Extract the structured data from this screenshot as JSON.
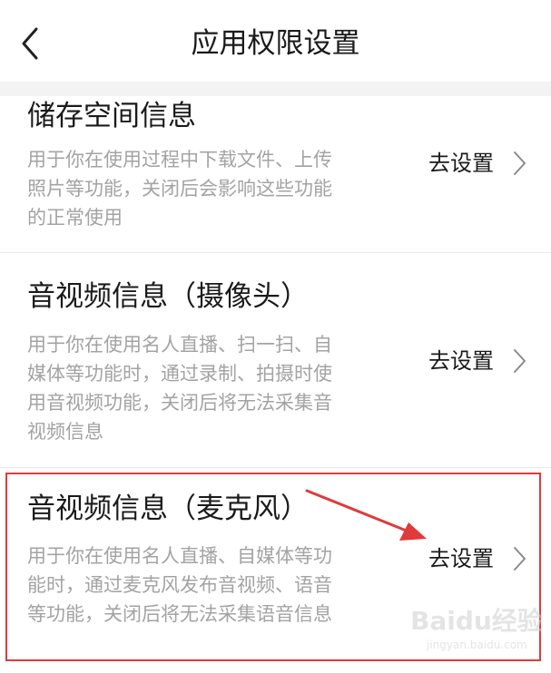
{
  "header": {
    "title": "应用权限设置",
    "back_icon": "chevron-left-icon"
  },
  "items": [
    {
      "title": "储存空间信息",
      "desc_lines": [
        "用于你在使用过程中下载文件、上传",
        "照片等功能，关闭后会影响这些功能",
        "的正常使用"
      ],
      "action": "去设置"
    },
    {
      "title": "音视频信息（摄像头）",
      "desc_lines": [
        "用于你在使用名人直播、扫一扫、自",
        "媒体等功能时，通过录制、拍摄时使",
        "用音视频功能，关闭后将无法采集音",
        "视频信息"
      ],
      "action": "去设置"
    },
    {
      "title": "音视频信息（麦克风）",
      "desc_lines": [
        "用于你在使用名人直播、自媒体等功",
        "能时，通过麦克风发布音视频、语音",
        "等功能，关闭后将无法采集语音信息"
      ],
      "action": "去设置"
    }
  ],
  "annotation": {
    "highlight_color": "#e03a3a"
  },
  "watermark": {
    "text": "Baidu经验",
    "sub": "jingyan.baidu.com"
  }
}
